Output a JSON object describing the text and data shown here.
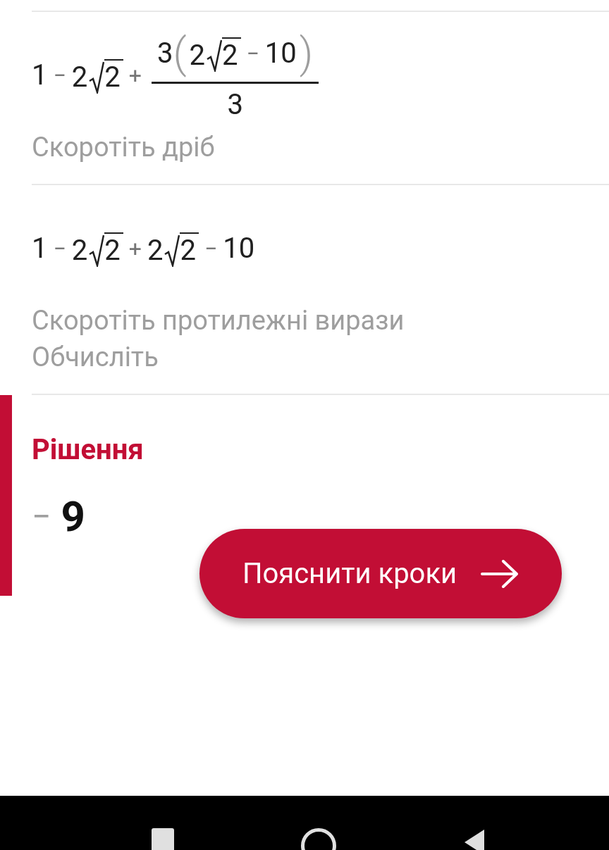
{
  "steps": [
    {
      "expression": [
        {
          "kind": "num",
          "text": "1"
        },
        {
          "kind": "op",
          "text": "−"
        },
        {
          "kind": "sqrt",
          "coef": "2",
          "radicand": "2"
        },
        {
          "kind": "op",
          "text": "+"
        },
        {
          "kind": "frac",
          "numerator": [
            {
              "kind": "num",
              "text": "3"
            },
            {
              "kind": "paren",
              "open": "(",
              "close": ")",
              "children": [
                {
                  "kind": "sqrt",
                  "coef": "2",
                  "radicand": "2"
                },
                {
                  "kind": "op",
                  "text": "−"
                },
                {
                  "kind": "num",
                  "text": "10"
                }
              ]
            }
          ],
          "denominator": [
            {
              "kind": "num",
              "text": "3"
            }
          ]
        }
      ],
      "notes": [
        "Скоротіть дріб"
      ]
    },
    {
      "expression": [
        {
          "kind": "num",
          "text": "1"
        },
        {
          "kind": "op",
          "text": "−"
        },
        {
          "kind": "sqrt",
          "coef": "2",
          "radicand": "2"
        },
        {
          "kind": "op",
          "text": "+"
        },
        {
          "kind": "sqrt",
          "coef": "2",
          "radicand": "2"
        },
        {
          "kind": "op",
          "text": "−"
        },
        {
          "kind": "num",
          "text": "10"
        }
      ],
      "notes": [
        "Скоротіть протилежні вирази",
        "Обчисліть"
      ]
    }
  ],
  "solution": {
    "title": "Рішення",
    "sign": "−",
    "value": "9"
  },
  "button": {
    "label": "Пояснити кроки"
  }
}
